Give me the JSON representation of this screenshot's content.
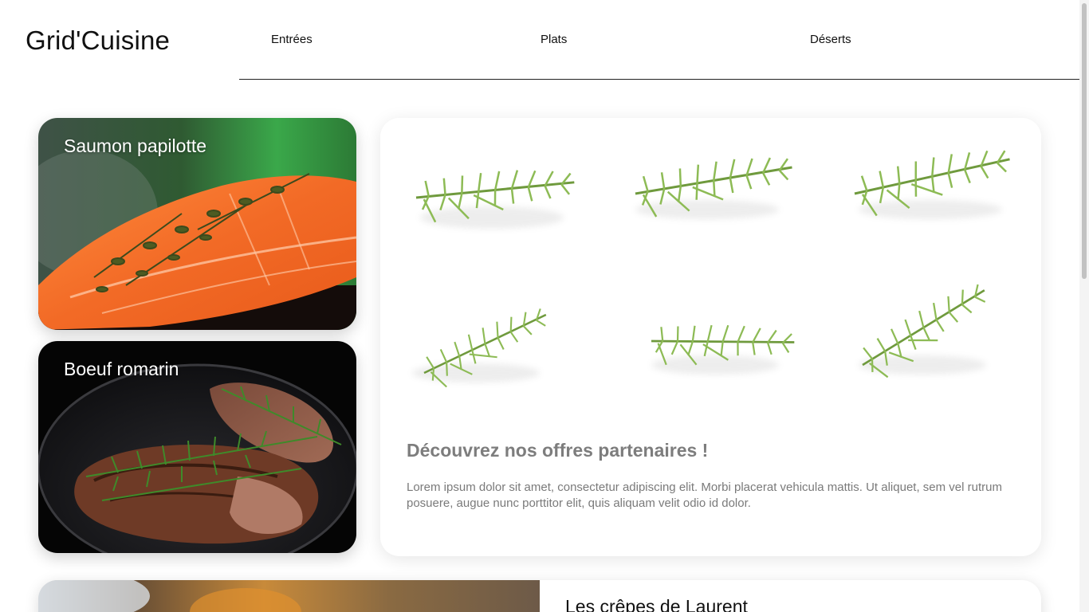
{
  "header": {
    "logo": "Grid'Cuisine",
    "nav": [
      "Entrées",
      "Plats",
      "Déserts"
    ]
  },
  "cards": [
    {
      "title": "Saumon papilotte",
      "image": "salmon-photo"
    },
    {
      "title": "Boeuf romarin",
      "image": "beef-rosemary-photo"
    }
  ],
  "partner": {
    "heading": "Découvrez nos offres partenaires !",
    "text": "Lorem ipsum dolor sit amet, consectetur adipiscing elit. Morbi placerat vehicula mattis. Ut aliquet, sem vel rutrum posuere, augue nunc porttitor elit, quis aliquam velit odio id dolor.",
    "image": "rosemary-sprigs-photo"
  },
  "bottom_card": {
    "title": "Les crêpes de Laurent",
    "image": "crepes-photo"
  },
  "colors": {
    "accent_text": "#7d7d7d",
    "nav_line": "#222222"
  }
}
